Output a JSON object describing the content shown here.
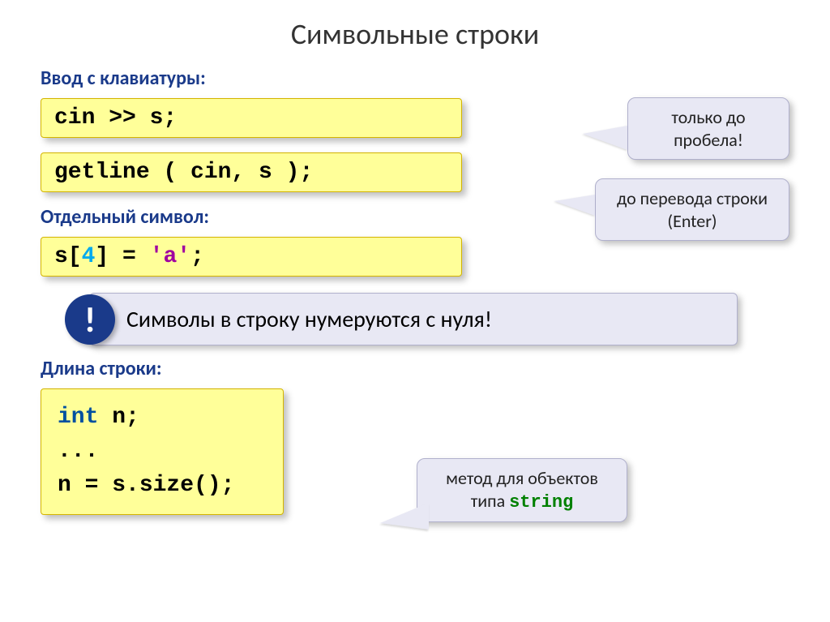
{
  "title": "Символьные строки",
  "sections": {
    "input": "Ввод с клавиатуры:",
    "char": "Отдельный символ:",
    "length": "Длина строки:"
  },
  "code": {
    "cin": {
      "text": "cin >> s;"
    },
    "getline": {
      "text": "getline ( cin, s );"
    },
    "indexing": {
      "p1": "s[",
      "num": "4",
      "p2": "] = ",
      "str": "'a'",
      "p3": ";"
    },
    "size": {
      "l1_kw": "int",
      "l1_rest": " n;",
      "l2": "...",
      "l3": "n = s.size();"
    }
  },
  "callouts": {
    "c1": "только до пробела!",
    "c2": "до перевода строки (Enter)",
    "c3_a": "метод для объектов типа ",
    "c3_b": "string"
  },
  "info": {
    "bang": "!",
    "text": "Символы в строку нумеруются с нуля!"
  }
}
